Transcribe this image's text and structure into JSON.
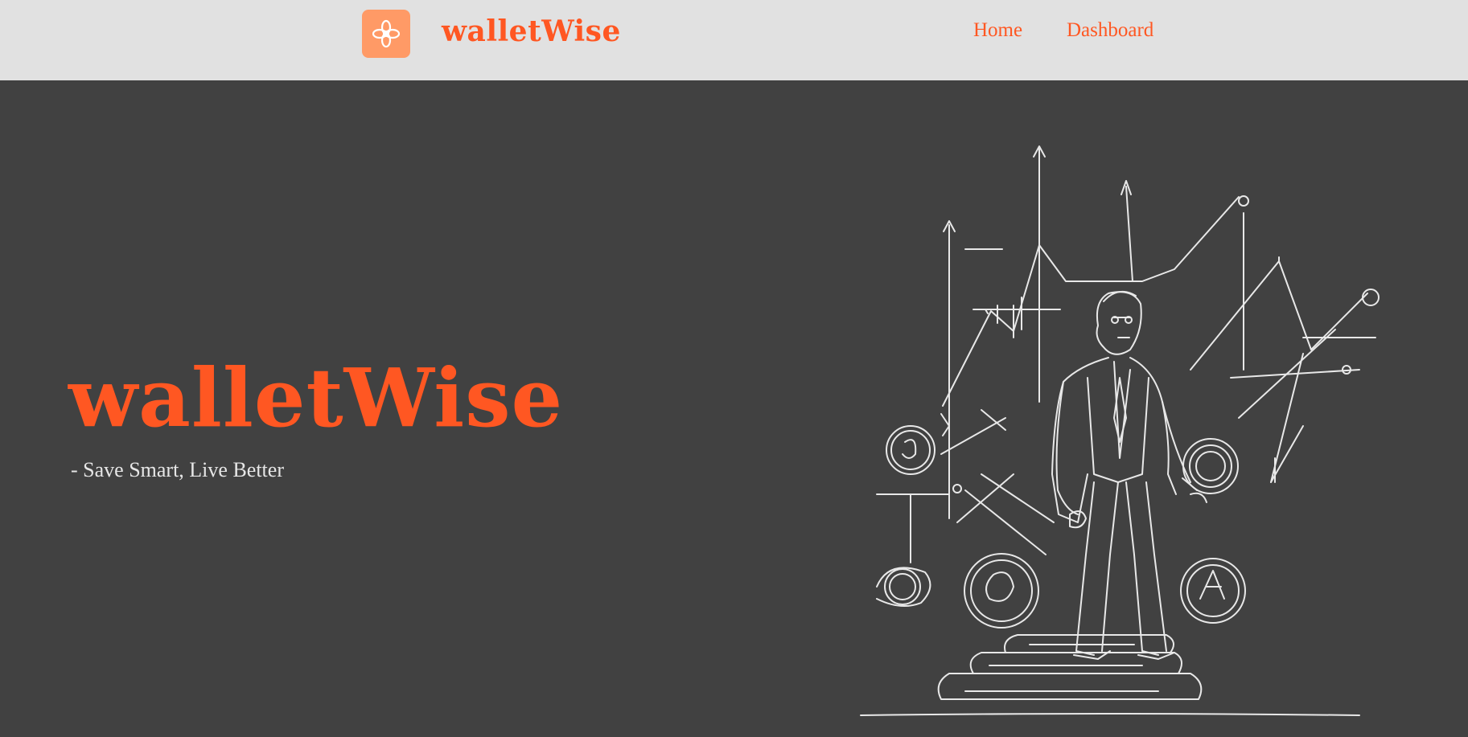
{
  "navbar": {
    "brand": "walletWise",
    "logo_icon": "flower-swirl-icon",
    "links": [
      {
        "label": "Home"
      },
      {
        "label": "Dashboard"
      }
    ]
  },
  "hero": {
    "title": "walletWise",
    "subtitle": "- Save Smart, Live Better",
    "illustration": "businessman-with-finance-charts-illustration"
  },
  "colors": {
    "accent": "#ff5722",
    "logo_bg": "#ff9a66",
    "nav_bg": "#e1e1e1",
    "page_bg": "#414141",
    "line_art": "#e8e8e8"
  }
}
